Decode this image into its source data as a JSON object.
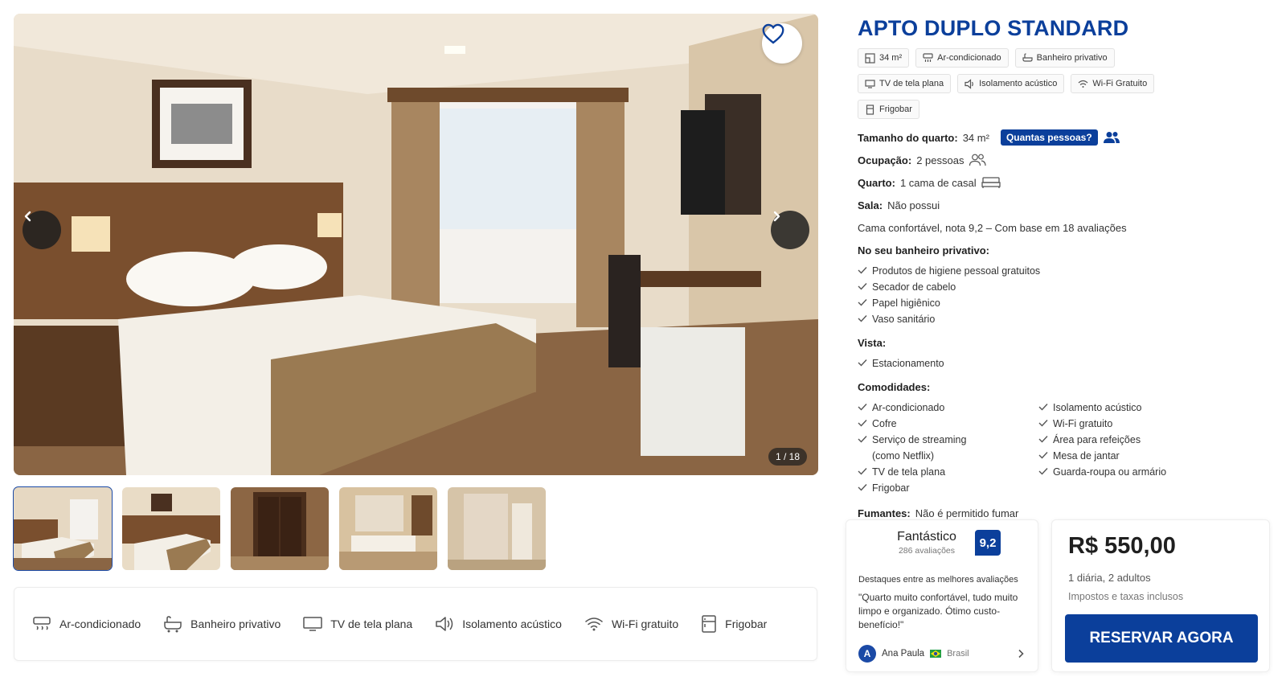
{
  "gallery": {
    "counter": "1 / 18",
    "favorite_icon": "heart-icon",
    "prev_icon": "chevron-left-icon",
    "next_icon": "chevron-right-icon",
    "thumbnails": [
      "quarto-visao-geral",
      "quarto-cama",
      "armario",
      "banheiro-pia",
      "banheiro-chuveiro"
    ],
    "selected_thumbnail": 0
  },
  "amenity_bar": [
    {
      "icon": "air-conditioner-icon",
      "label": "Ar-condicionado"
    },
    {
      "icon": "bath-icon",
      "label": "Banheiro privativo"
    },
    {
      "icon": "tv-icon",
      "label": "TV de tela plana"
    },
    {
      "icon": "speaker-icon",
      "label": "Isolamento acústico"
    },
    {
      "icon": "wifi-icon",
      "label": "Wi-Fi gratuito"
    },
    {
      "icon": "fridge-icon",
      "label": "Frigobar"
    }
  ],
  "room": {
    "title": "APTO DUPLO STANDARD",
    "chips": [
      {
        "icon": "area-icon",
        "label": "34 m²"
      },
      {
        "icon": "air-conditioner-icon",
        "label": "Ar-condicionado"
      },
      {
        "icon": "bath-icon",
        "label": "Banheiro privativo"
      },
      {
        "icon": "tv-icon",
        "label": "TV de tela plana"
      },
      {
        "icon": "speaker-icon",
        "label": "Isolamento acústico"
      },
      {
        "icon": "wifi-icon",
        "label": "Wi-Fi Gratuito"
      },
      {
        "icon": "fridge-icon",
        "label": "Frigobar"
      }
    ],
    "size_label": "Tamanho do quarto:",
    "size_value": "34 m²",
    "people_button": "Quantas pessoas?",
    "occupancy_label": "Ocupação:",
    "occupancy_value": "2 pessoas",
    "bed_label": "Quarto:",
    "bed_value": "1 cama de casal",
    "living_label": "Sala:",
    "living_value": "Não possui",
    "comfort_text": "Cama confortável, nota 9,2 – Com base em 18 avaliações",
    "bathroom_title": "No seu banheiro privativo:",
    "bathroom_items": [
      "Produtos de higiene pessoal gratuitos",
      "Secador de cabelo",
      "Papel higiênico",
      "Vaso sanitário"
    ],
    "view_title": "Vista:",
    "view_items": [
      "Estacionamento"
    ],
    "amenities_title": "Comodidades:",
    "amenities_left": [
      "Ar-condicionado",
      "Cofre",
      "Serviço de streaming (como Netflix)",
      "TV de tela plana",
      "Frigobar"
    ],
    "amenities_right": [
      "Isolamento acústico",
      "Wi-Fi gratuito",
      "Área para refeições",
      "Mesa de jantar",
      "Guarda-roupa ou armário"
    ],
    "smoking_label": "Fumantes:",
    "smoking_value": "Não é permitido fumar"
  },
  "review": {
    "title": "Fantástico",
    "count": "286 avaliações",
    "score": "9,2",
    "highlight": "Destaques entre as melhores avaliações",
    "quote": "\"Quarto muito confortável, tudo muito limpo e organizado. Ótimo custo-benefício!\"",
    "author_initial": "A",
    "author": "Ana Paula",
    "country": "Brasil"
  },
  "pricing": {
    "price": "R$ 550,00",
    "stay": "1 diária, 2 adultos",
    "taxes": "Impostos e taxas inclusos",
    "button": "RESERVAR AGORA"
  },
  "colors": {
    "brand": "#0b3f9b",
    "check": "#555555"
  }
}
